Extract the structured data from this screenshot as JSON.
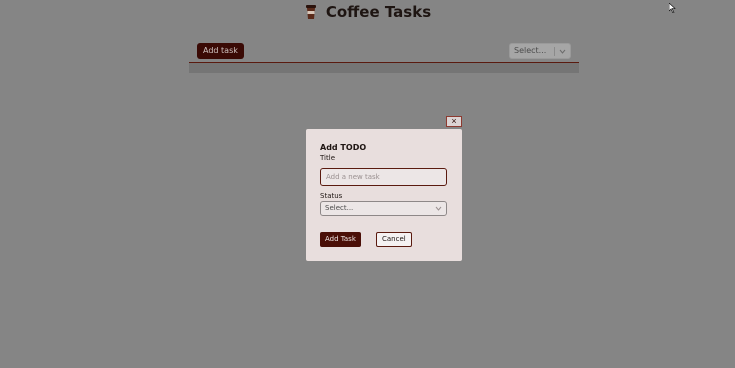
{
  "header": {
    "title": "Coffee Tasks",
    "logo_icon": "coffee-cup-icon"
  },
  "toolbar": {
    "add_task_label": "Add task",
    "filter": {
      "placeholder": "Select...",
      "icon": "chevron-down-icon"
    }
  },
  "modal": {
    "close_label": "×",
    "heading": "Add TODO",
    "title_label": "Title",
    "title_placeholder": "Add a new task",
    "title_value": "",
    "status_label": "Status",
    "status_placeholder": "Select...",
    "submit_label": "Add Task",
    "cancel_label": "Cancel"
  },
  "colors": {
    "overlay": "#858585",
    "accent": "#3a0a05",
    "modal_bg": "#e8dedd"
  }
}
